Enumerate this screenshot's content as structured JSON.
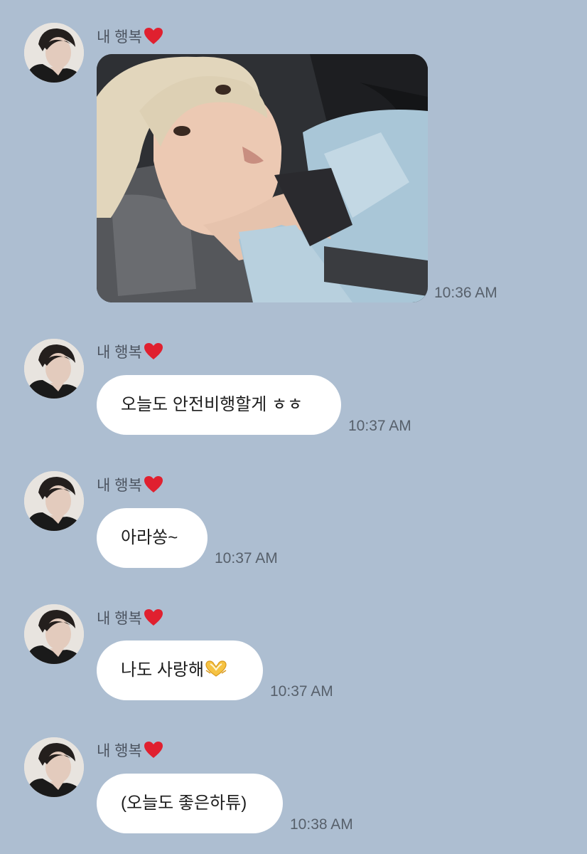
{
  "messages": [
    {
      "sender": "내 행복",
      "type": "photo",
      "time": "10:36 AM"
    },
    {
      "sender": "내 행복",
      "type": "text",
      "text": "오늘도 안전비행할게 ㅎㅎ",
      "time": "10:37 AM"
    },
    {
      "sender": "내 행복",
      "type": "text",
      "text": "아라쏭~",
      "time": "10:37 AM"
    },
    {
      "sender": "내 행복",
      "type": "text",
      "text": "나도 사랑해",
      "emoji": "heart-hands-icon",
      "time": "10:37 AM"
    },
    {
      "sender": "내 행복",
      "type": "text",
      "text": "(오늘도 좋은하튜)",
      "time": "10:38 AM"
    }
  ],
  "colors": {
    "background": "#adbed1",
    "bubble": "#ffffff",
    "heart": "#e0202f"
  }
}
